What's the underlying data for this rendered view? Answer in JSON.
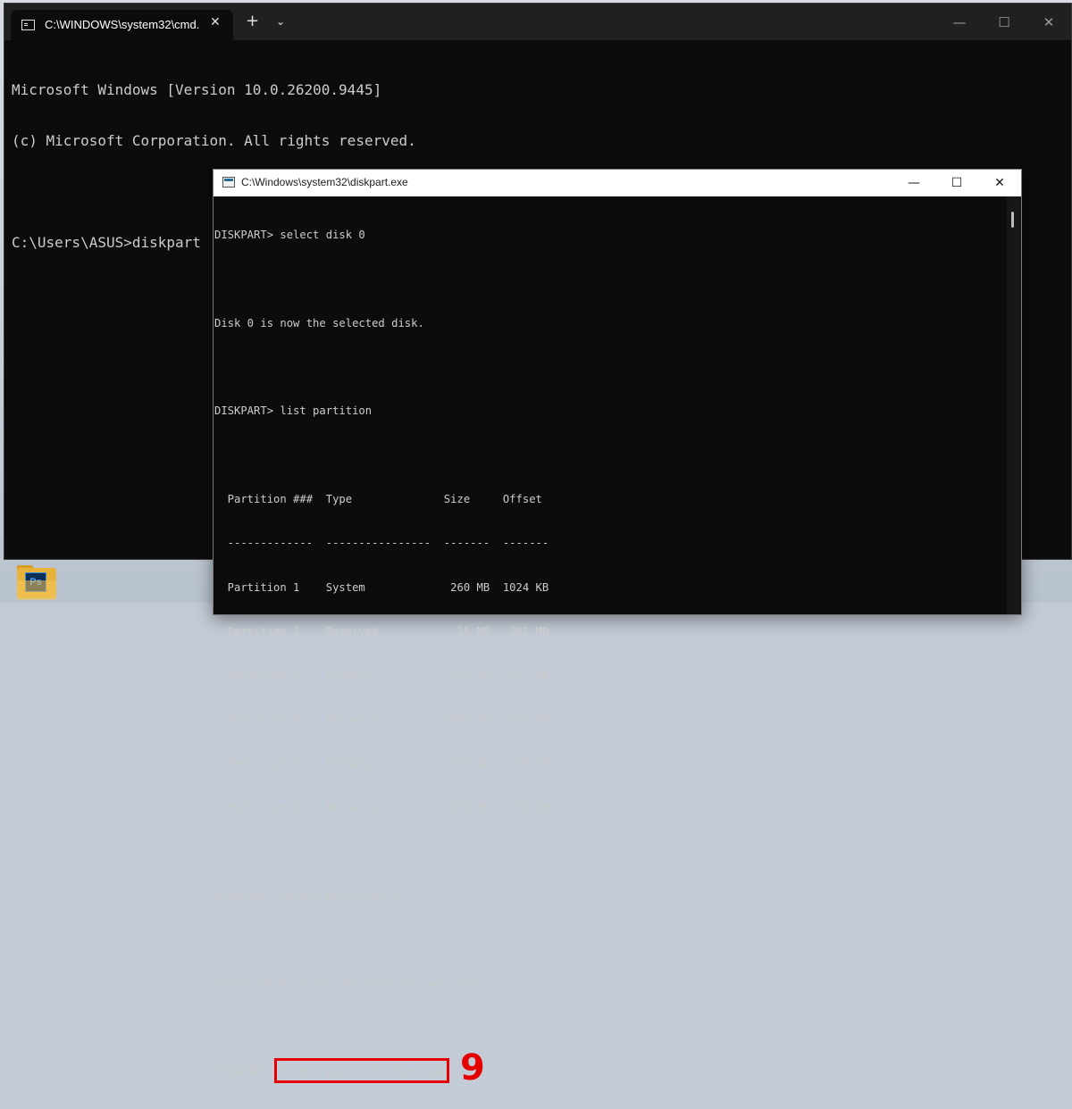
{
  "terminal": {
    "tab_title": "C:\\WINDOWS\\system32\\cmd.",
    "tab_close": "✕",
    "new_tab": "+",
    "dropdown": "⌄",
    "controls": {
      "minimize": "—",
      "maximize": "☐",
      "close": "✕"
    },
    "lines": [
      "Microsoft Windows [Version 10.0.26200.9445]",
      "(c) Microsoft Corporation. All rights reserved.",
      "",
      "C:\\Users\\ASUS>diskpart"
    ]
  },
  "diskpart": {
    "title": "C:\\Windows\\system32\\diskpart.exe",
    "controls": {
      "minimize": "—",
      "maximize": "☐",
      "close": "✕"
    },
    "lines": [
      "DISKPART> select disk 0",
      "",
      "Disk 0 is now the selected disk.",
      "",
      "DISKPART> list partition",
      "",
      "  Partition ###  Type              Size     Offset",
      "  -------------  ----------------  -------  -------",
      "  Partition 1    System             260 MB  1024 KB",
      "  Partition 2    Reserved            16 MB   261 MB",
      "  Partition 3    Primary            225 GB   277 MB",
      "  Partition 4    Recovery          1047 MB   225 GB",
      "  Partition 5    Primary            250 GB   226 GB",
      "  Partition 6    Recovery           650 MB   476 GB",
      "",
      "DISKPART> select partition 4",
      "",
      "Partition 4 is now the selected partition.",
      ""
    ],
    "last_prompt": "DISKPART> ",
    "last_command": "delete partition override",
    "step_number": "9"
  },
  "taskbar": {
    "folder_badge": "Ps"
  }
}
